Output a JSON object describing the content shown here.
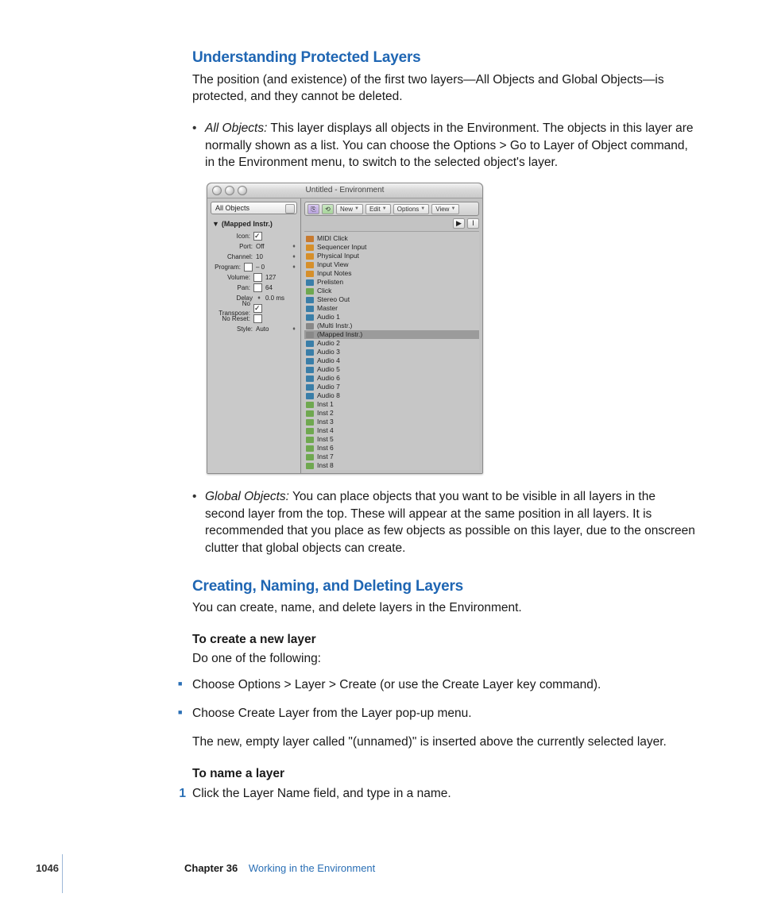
{
  "headings": {
    "h1": "Understanding Protected Layers",
    "h2": "Creating, Naming, and Deleting Layers"
  },
  "intro1": "The position (and existence) of the first two layers—All Objects and Global Objects—is protected, and they cannot be deleted.",
  "bullet1_term": "All Objects:",
  "bullet1_text": "  This layer displays all objects in the Environment. The objects in this layer are normally shown as a list. You can choose the Options > Go to Layer of Object command, in the Environment menu, to switch to the selected object's layer.",
  "bullet2_term": "Global Objects:",
  "bullet2_text": "  You can place objects that you want to be visible in all layers in the second layer from the top. These will appear at the same position in all layers. It is recommended that you place as few objects as possible on this layer, due to the onscreen clutter that global objects can create.",
  "intro2": "You can create, name, and delete layers in the Environment.",
  "sub1": "To create a new layer",
  "sub1_intro": "Do one of the following:",
  "sq1": "Choose Options > Layer > Create (or use the Create Layer key command).",
  "sq2": "Choose Create Layer from the Layer pop-up menu.",
  "sq_after": "The new, empty layer called \"(unnamed)\" is inserted above the currently selected layer.",
  "sub2": "To name a layer",
  "step1_num": "1",
  "step1": "Click the Layer Name field, and type in a name.",
  "env": {
    "title": "Untitled - Environment",
    "layer_selector": "All Objects",
    "inspector_head": "(Mapped Instr.)",
    "params": {
      "icon_lbl": "Icon:",
      "port_lbl": "Port:",
      "port_val": "Off",
      "channel_lbl": "Channel:",
      "channel_val": "10",
      "program_lbl": "Program:",
      "program_val": "–    0",
      "volume_lbl": "Volume:",
      "volume_val": "127",
      "pan_lbl": "Pan:",
      "pan_val": "64",
      "delay_lbl": "Delay",
      "delay_val": "0.0 ms",
      "notrans_lbl": "No Transpose:",
      "noreset_lbl": "No Reset:",
      "style_lbl": "Style:",
      "style_val": "Auto"
    },
    "toolbar": {
      "new": "New",
      "edit": "Edit",
      "options": "Options",
      "view": "View"
    },
    "objects": [
      {
        "n": "MIDI Click",
        "c": "met"
      },
      {
        "n": "Sequencer Input",
        "c": "folder"
      },
      {
        "n": "Physical Input",
        "c": "folder"
      },
      {
        "n": "Input View",
        "c": "folder"
      },
      {
        "n": "Input Notes",
        "c": "folder"
      },
      {
        "n": "Prelisten",
        "c": "bus"
      },
      {
        "n": "Click",
        "c": "grn"
      },
      {
        "n": "Stereo Out",
        "c": "bus"
      },
      {
        "n": "Master",
        "c": "bus"
      },
      {
        "n": "Audio 1",
        "c": "bus"
      },
      {
        "n": "(Multi Instr.)",
        "c": "gray"
      },
      {
        "n": "(Mapped Instr.)",
        "c": "gray",
        "sel": true
      },
      {
        "n": "Audio 2",
        "c": "bus"
      },
      {
        "n": "Audio 3",
        "c": "bus"
      },
      {
        "n": "Audio 4",
        "c": "bus"
      },
      {
        "n": "Audio 5",
        "c": "bus"
      },
      {
        "n": "Audio 6",
        "c": "bus"
      },
      {
        "n": "Audio 7",
        "c": "bus"
      },
      {
        "n": "Audio 8",
        "c": "bus"
      },
      {
        "n": "Inst 1",
        "c": "grn"
      },
      {
        "n": "Inst 2",
        "c": "grn"
      },
      {
        "n": "Inst 3",
        "c": "grn"
      },
      {
        "n": "Inst 4",
        "c": "grn"
      },
      {
        "n": "Inst 5",
        "c": "grn"
      },
      {
        "n": "Inst 6",
        "c": "grn"
      },
      {
        "n": "Inst 7",
        "c": "grn"
      },
      {
        "n": "Inst 8",
        "c": "grn"
      }
    ]
  },
  "footer": {
    "page": "1046",
    "chapter_lbl": "Chapter 36",
    "chapter_title": "Working in the Environment"
  }
}
